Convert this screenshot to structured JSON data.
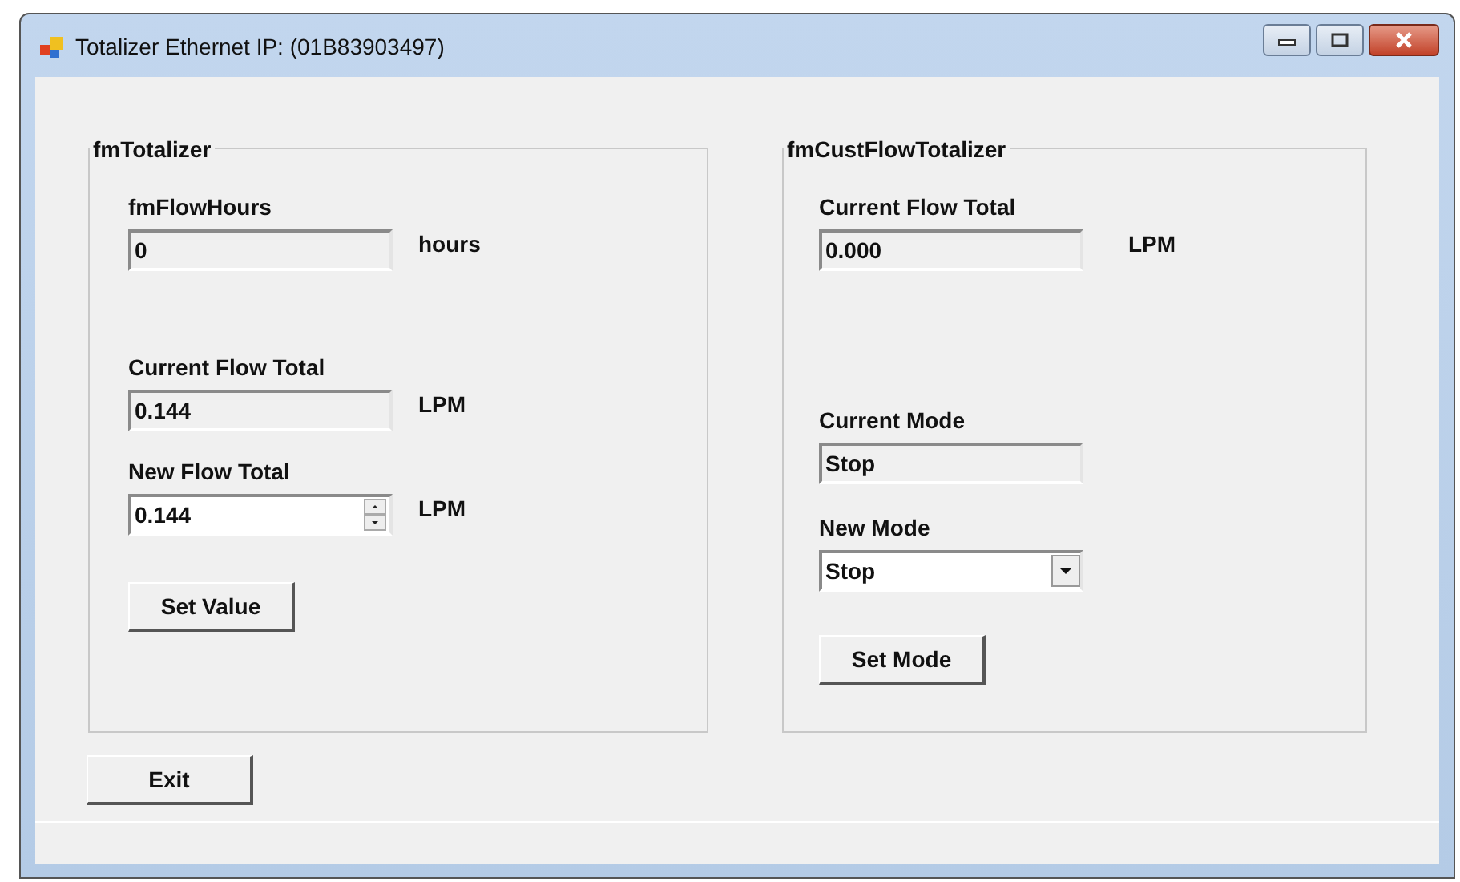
{
  "window": {
    "title": "Totalizer Ethernet IP: (01B83903497)"
  },
  "groups": [
    {
      "title": "fmTotalizer",
      "rows": [
        {
          "kind": "readonly",
          "label": "fmFlowHours",
          "value": "0",
          "unit": "hours"
        },
        {
          "kind": "readonly",
          "label": "Current Flow Total",
          "value": "0.144",
          "unit": "LPM"
        },
        {
          "kind": "spin",
          "label": "New Flow Total",
          "value": "0.144",
          "unit": "LPM"
        }
      ],
      "button": "Set Value"
    },
    {
      "title": "fmCustFlowTotalizer",
      "rows": [
        {
          "kind": "readonly",
          "label": "Current Flow Total",
          "value": "0.000",
          "unit": "LPM"
        },
        {
          "kind": "readonly",
          "label": "Current Mode",
          "value": "Stop"
        },
        {
          "kind": "combo",
          "label": "New Mode",
          "value": "Stop"
        }
      ],
      "button": "Set Mode"
    }
  ],
  "exit_button": "Exit"
}
